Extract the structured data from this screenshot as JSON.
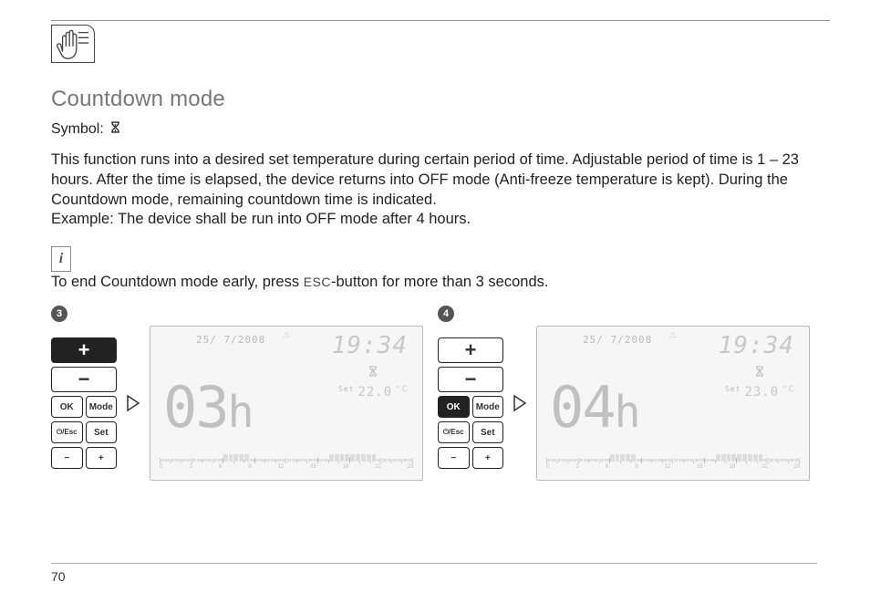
{
  "page_number": "70",
  "section": {
    "title": "Countdown mode",
    "symbol_label": "Symbol:",
    "symbol_icon_name": "hourglass-icon",
    "paragraph": "This function runs into a desired set temperature during certain period of time. Adjustable period of time is 1 – 23 hours. After the time is elapsed, the device returns into OFF mode (Anti-freeze temperature is kept). During the Countdown mode, remaining countdown time is indicated.\nExample: The device shall be run into OFF mode after 4 hours.",
    "info_text_before": "To end Countdown mode early, press ",
    "info_esc": "ESC",
    "info_text_after": "-button for more than 3 seconds."
  },
  "keypad_labels": {
    "plus": "+",
    "minus": "−",
    "ok": "OK",
    "mode": "Mode",
    "esc": "⏻/Esc",
    "set": "Set",
    "small_minus": "−",
    "small_plus": "+"
  },
  "figures": [
    {
      "step": "3",
      "pressed_key": "plus",
      "display": {
        "date": "25/ 7/2008",
        "time": "19:34",
        "mode_icon": "hourglass",
        "set_label": "Set",
        "set_temp": "22.0",
        "temp_unit": "°C",
        "main_value": "03",
        "main_unit": "h",
        "timeline_labels": [
          "0",
          "",
          "3",
          "",
          "6",
          "",
          "9",
          "",
          "12",
          "",
          "15",
          "",
          "18",
          "",
          "21",
          "",
          "23"
        ]
      }
    },
    {
      "step": "4",
      "pressed_key": "ok",
      "display": {
        "date": "25/ 7/2008",
        "time": "19:34",
        "mode_icon": "hourglass",
        "set_label": "Set",
        "set_temp": "23.0",
        "temp_unit": "°C",
        "main_value": "04",
        "main_unit": "h",
        "timeline_labels": [
          "0",
          "",
          "3",
          "",
          "6",
          "",
          "9",
          "",
          "12",
          "",
          "15",
          "",
          "18",
          "",
          "21",
          "",
          "23"
        ]
      }
    }
  ]
}
